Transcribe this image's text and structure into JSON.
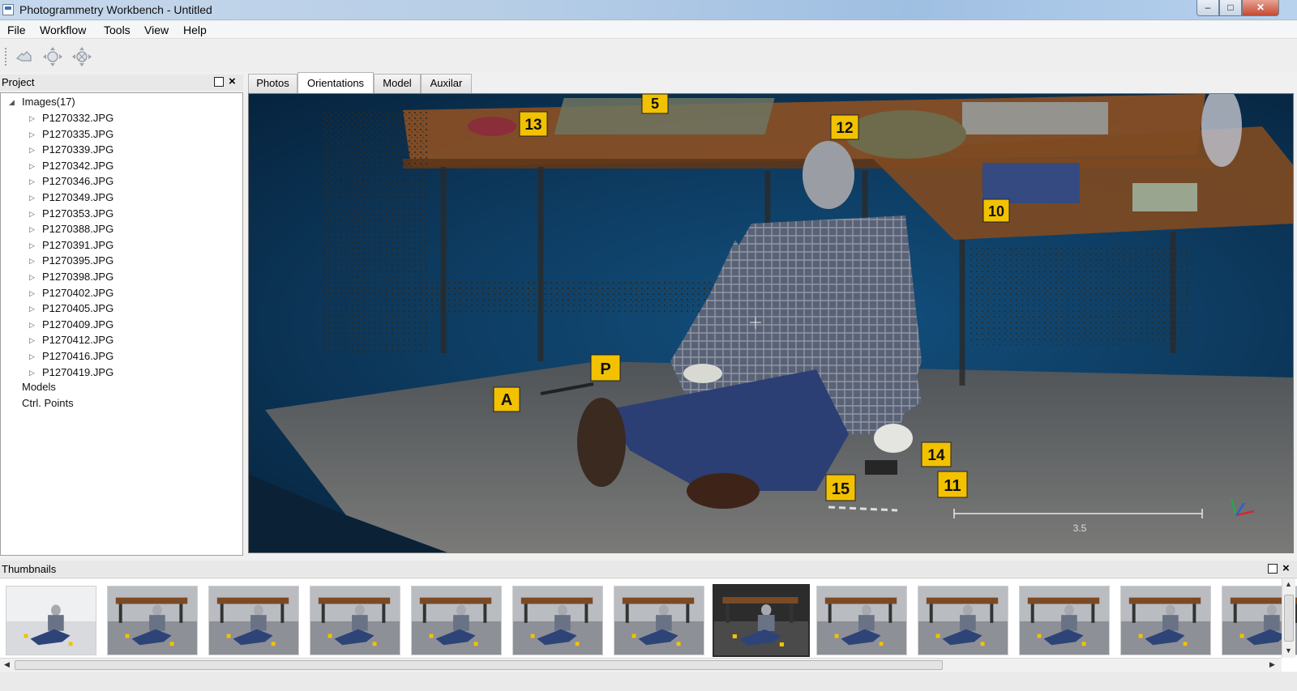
{
  "window": {
    "title": "Photogrammetry Workbench - Untitled",
    "min_glyph": "–",
    "max_glyph": "□",
    "close_glyph": "✕"
  },
  "menu": [
    "File",
    "Workflow",
    "Tools",
    "View",
    "Help"
  ],
  "toolbar": {
    "icons": [
      "hand-pan-icon",
      "move-tool-icon",
      "rotate-tool-icon"
    ]
  },
  "project": {
    "title": "Project",
    "root_label": "Images(17)",
    "images": [
      "P1270332.JPG",
      "P1270335.JPG",
      "P1270339.JPG",
      "P1270342.JPG",
      "P1270346.JPG",
      "P1270349.JPG",
      "P1270353.JPG",
      "P1270388.JPG",
      "P1270391.JPG",
      "P1270395.JPG",
      "P1270398.JPG",
      "P1270402.JPG",
      "P1270405.JPG",
      "P1270409.JPG",
      "P1270412.JPG",
      "P1270416.JPG",
      "P1270419.JPG"
    ],
    "models_label": "Models",
    "ctrl_points_label": "Ctrl. Points"
  },
  "tabs": [
    {
      "label": "Photos",
      "active": false
    },
    {
      "label": "Orientations",
      "active": true
    },
    {
      "label": "Model",
      "active": false
    },
    {
      "label": "Auxilar",
      "active": false
    }
  ],
  "viewport": {
    "scale_label": "3.5",
    "evidence_markers": [
      "13",
      "5",
      "12",
      "10",
      "P",
      "A",
      "14",
      "15",
      "11"
    ],
    "colors": {
      "background": "#0e3d63",
      "marker": "#f2c200",
      "table": "#8a4f24",
      "floor": "#6b6b6b"
    }
  },
  "thumbnails": {
    "title": "Thumbnails",
    "count": 13,
    "selected_index": 7
  }
}
